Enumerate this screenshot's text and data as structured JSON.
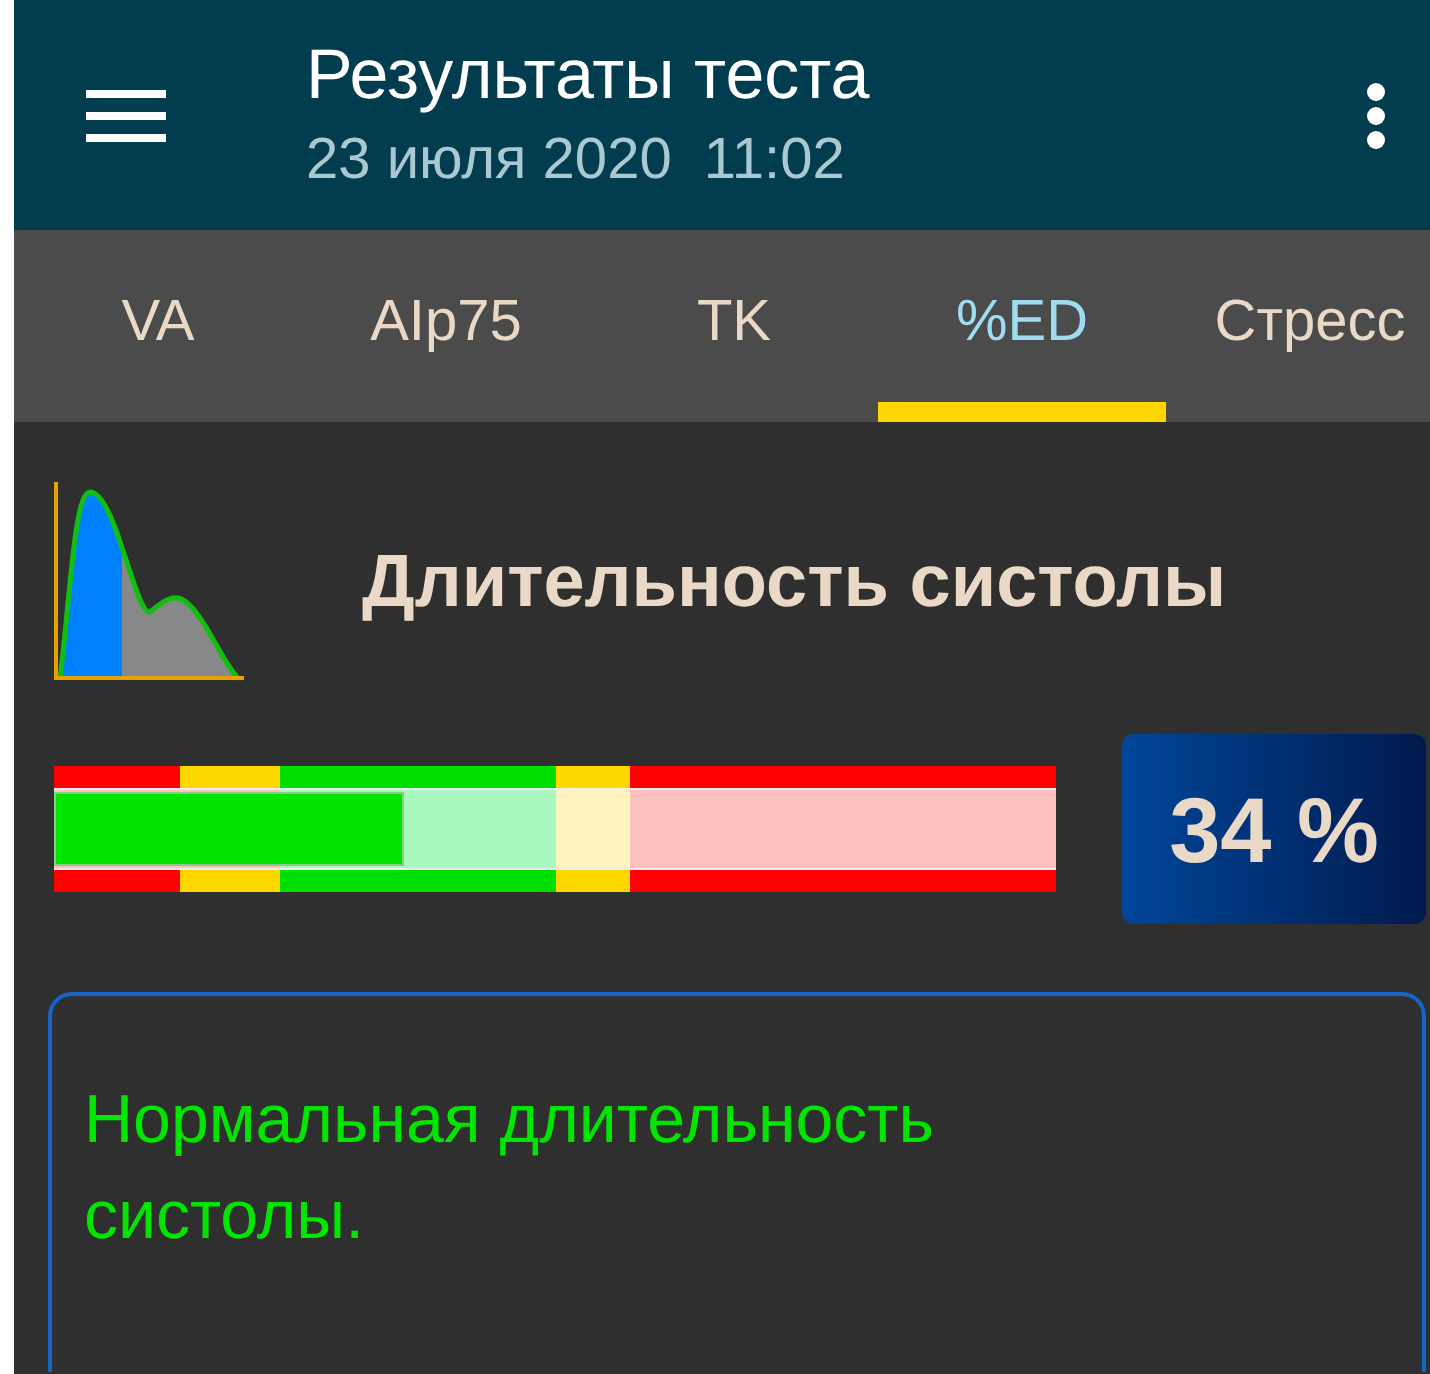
{
  "app_bar": {
    "title": "Результаты теста",
    "subtitle": "23 июля 2020  11:02"
  },
  "tabs": [
    {
      "label": "VA",
      "selected": false
    },
    {
      "label": "AIp75",
      "selected": false
    },
    {
      "label": "TK",
      "selected": false
    },
    {
      "label": "%ED",
      "selected": true
    },
    {
      "label": "Стресс",
      "selected": false
    }
  ],
  "indicator": {
    "title": "Длительность систолы",
    "level": 0.35,
    "value": "34 %"
  },
  "conclusion": {
    "text": "Нормальная длительность систолы."
  }
}
